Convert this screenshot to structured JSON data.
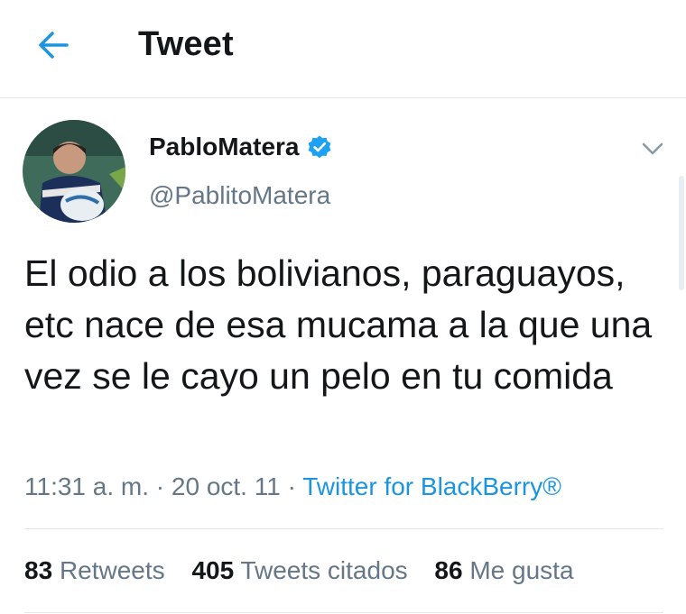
{
  "header": {
    "title": "Tweet",
    "back_icon": "arrow-left-icon"
  },
  "tweet": {
    "display_name": "PabloMatera",
    "handle": "@PablitoMatera",
    "verified_icon": "verified-badge-icon",
    "text": "El odio a los bolivianos, paraguayos, etc nace de esa mucama a la que una vez se le cayo un pelo en tu comida",
    "time": "11:31 a. m.",
    "date": "20 oct. 11",
    "source": "Twitter for BlackBerry®",
    "separator": " · "
  },
  "stats": {
    "retweets_count": "83",
    "retweets_label": "Retweets",
    "quotes_count": "405",
    "quotes_label": "Tweets citados",
    "likes_count": "86",
    "likes_label": "Me gusta"
  },
  "colors": {
    "accent": "#1b95e0",
    "muted": "#657786",
    "text": "#14171a",
    "divider": "#e1e8ed"
  }
}
